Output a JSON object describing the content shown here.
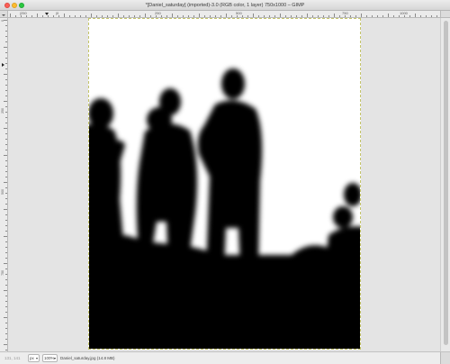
{
  "window": {
    "title": "*[Daniel_saturday] (imported)-3.0 (RGB color, 1 layer) 750x1000 – GIMP"
  },
  "ruler": {
    "h_labels": [
      "|250",
      "|0",
      "250",
      "500",
      "750",
      "1000"
    ],
    "v_labels": [
      "0",
      "250",
      "500",
      "750"
    ]
  },
  "statusbar": {
    "coordinates": "131, 141",
    "unit": "px",
    "zoom": "100%",
    "file_info": "Daniel_saturday.jpg (14.8 MB)"
  },
  "colors": {
    "titlebar": "#ececec",
    "canvas_bg": "#e4e4e4",
    "image_border": "#c4c46a"
  },
  "icons": [
    "window-close-icon",
    "window-minimize-icon",
    "window-maximize-icon",
    "navigate-image-icon",
    "ruler-menu-icon"
  ]
}
